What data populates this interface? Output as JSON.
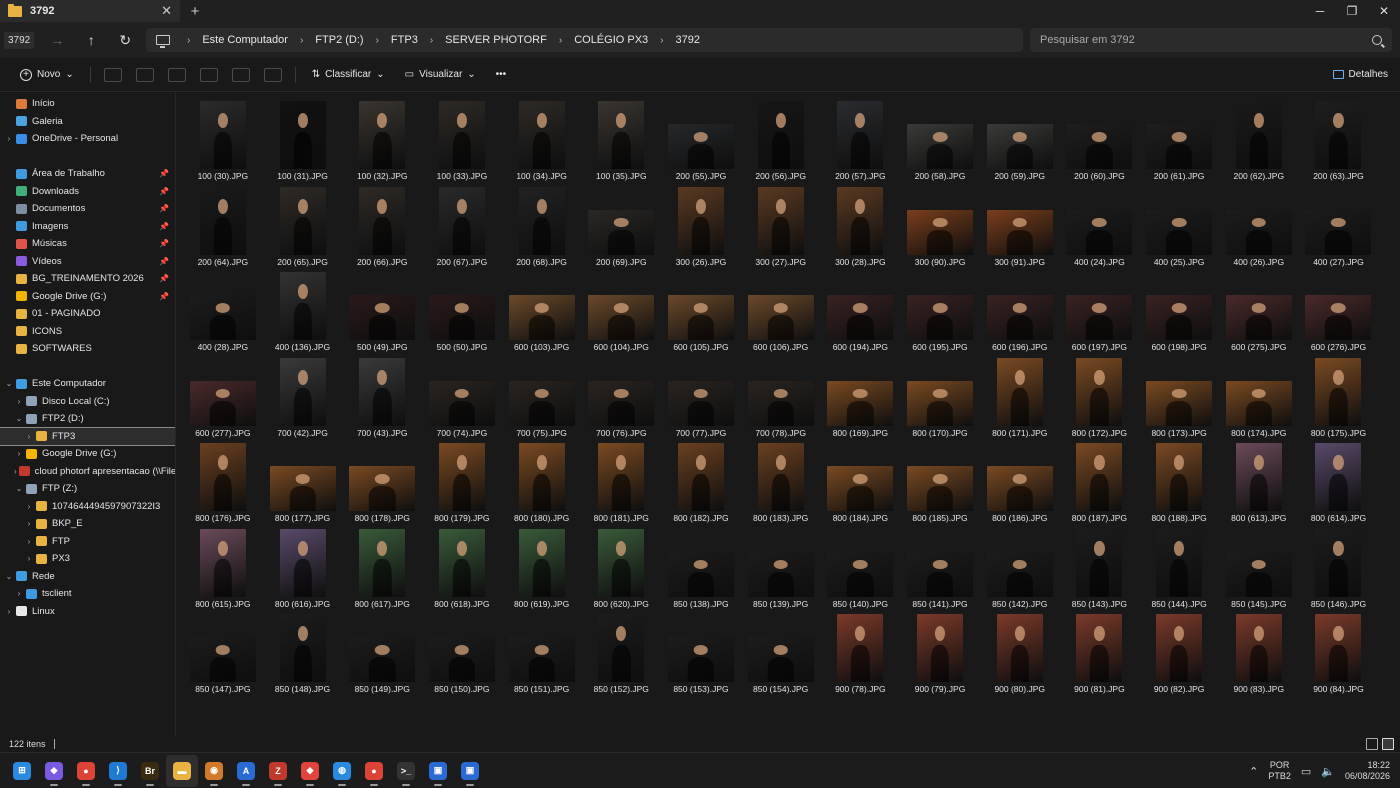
{
  "window": {
    "tab_title": "3792",
    "mini_title": "3792"
  },
  "breadcrumb": [
    "Este Computador",
    "FTP2 (D:)",
    "FTP3",
    "SERVER PHOTORF",
    "COLÉGIO PX3",
    "3792"
  ],
  "search": {
    "placeholder": "Pesquisar em 3792"
  },
  "toolbar": {
    "new_label": "Novo",
    "sort_label": "Classificar",
    "view_label": "Visualizar",
    "details_label": "Detalhes"
  },
  "sidebar": {
    "quick": [
      {
        "label": "Início",
        "icon": "home-icon",
        "color": "#e07a3c"
      },
      {
        "label": "Galeria",
        "icon": "gallery-icon",
        "color": "#4aa3df"
      },
      {
        "label": "OneDrive - Personal",
        "icon": "cloud-icon",
        "color": "#3a8ee6",
        "chev": "›"
      }
    ],
    "pinned": [
      {
        "label": "Área de Trabalho",
        "icon": "desktop-icon",
        "color": "#3f9be0"
      },
      {
        "label": "Downloads",
        "icon": "download-icon",
        "color": "#3fb07a"
      },
      {
        "label": "Documentos",
        "icon": "documents-icon",
        "color": "#7d8ea3"
      },
      {
        "label": "Imagens",
        "icon": "pictures-icon",
        "color": "#3f9be0"
      },
      {
        "label": "Músicas",
        "icon": "music-icon",
        "color": "#e0544a"
      },
      {
        "label": "Vídeos",
        "icon": "video-icon",
        "color": "#8a5ae0"
      },
      {
        "label": "BG_TREINAMENTO 2026",
        "icon": "folder-icon",
        "color": "#e8b341"
      },
      {
        "label": "Google Drive (G:)",
        "icon": "drive-icon",
        "color": "#f4b400"
      },
      {
        "label": "01 - PAGINADO",
        "icon": "folder-icon",
        "color": "#e8b341"
      },
      {
        "label": "ICONS",
        "icon": "folder-icon",
        "color": "#e8b341"
      },
      {
        "label": "SOFTWARES",
        "icon": "folder-icon",
        "color": "#e8b341"
      }
    ],
    "tree": [
      {
        "label": "Este Computador",
        "icon": "pc-icon",
        "color": "#3f9be0",
        "chev": "⌄",
        "indent": 0
      },
      {
        "label": "Disco Local (C:)",
        "icon": "disk-icon",
        "color": "#8fa3b8",
        "chev": "›",
        "indent": 1
      },
      {
        "label": "FTP2 (D:)",
        "icon": "disk-icon",
        "color": "#8fa3b8",
        "chev": "⌄",
        "indent": 1
      },
      {
        "label": "FTP3",
        "icon": "folder-icon",
        "color": "#e8b341",
        "chev": "›",
        "indent": 2,
        "selected": true
      },
      {
        "label": "Google Drive (G:)",
        "icon": "drive-icon",
        "color": "#f4b400",
        "chev": "›",
        "indent": 1
      },
      {
        "label": "cloud photorf apresentacao (\\\\Files",
        "icon": "network-drive-icon",
        "color": "#c0392b",
        "chev": "›",
        "indent": 1
      },
      {
        "label": "FTP (Z:)",
        "icon": "network-drive-icon",
        "color": "#8fa3b8",
        "chev": "⌄",
        "indent": 1
      },
      {
        "label": "1074644494597907322I3",
        "icon": "folder-icon",
        "color": "#e8b341",
        "chev": "›",
        "indent": 2
      },
      {
        "label": "BKP_E",
        "icon": "folder-icon",
        "color": "#e8b341",
        "chev": "›",
        "indent": 2
      },
      {
        "label": "FTP",
        "icon": "folder-icon",
        "color": "#e8b341",
        "chev": "›",
        "indent": 2
      },
      {
        "label": "PX3",
        "icon": "folder-icon",
        "color": "#e8b341",
        "chev": "›",
        "indent": 2
      },
      {
        "label": "Rede",
        "icon": "network-icon",
        "color": "#3f9be0",
        "chev": "⌄",
        "indent": 0
      },
      {
        "label": "tsclient",
        "icon": "pc-icon",
        "color": "#3f9be0",
        "chev": "›",
        "indent": 1
      },
      {
        "label": "Linux",
        "icon": "linux-icon",
        "color": "#e8e8e8",
        "chev": "›",
        "indent": 0
      }
    ]
  },
  "files": [
    {
      "name": "100 (30).JPG",
      "o": "p",
      "c": "#2b2b2b"
    },
    {
      "name": "100 (31).JPG",
      "o": "p",
      "c": "#111111"
    },
    {
      "name": "100 (32).JPG",
      "o": "p",
      "c": "#3a3530"
    },
    {
      "name": "100 (33).JPG",
      "o": "p",
      "c": "#2e2a26"
    },
    {
      "name": "100 (34).JPG",
      "o": "p",
      "c": "#2e2a26"
    },
    {
      "name": "100 (35).JPG",
      "o": "p",
      "c": "#3a3530"
    },
    {
      "name": "200 (55).JPG",
      "o": "l",
      "c": "#26282a"
    },
    {
      "name": "200 (56).JPG",
      "o": "p",
      "c": "#161616"
    },
    {
      "name": "200 (57).JPG",
      "o": "p",
      "c": "#2a2c30"
    },
    {
      "name": "200 (58).JPG",
      "o": "l",
      "c": "#3a3a38"
    },
    {
      "name": "200 (59).JPG",
      "o": "l",
      "c": "#3a3a38"
    },
    {
      "name": "200 (60).JPG",
      "o": "l",
      "c": "#1e1e1e"
    },
    {
      "name": "200 (61).JPG",
      "o": "l",
      "c": "#1e1e1e"
    },
    {
      "name": "200 (62).JPG",
      "o": "p",
      "c": "#1a1a1a"
    },
    {
      "name": "200 (63).JPG",
      "o": "p",
      "c": "#1e1e1e"
    },
    {
      "name": "200 (64).JPG",
      "o": "p",
      "c": "#1a1a1a"
    },
    {
      "name": "200 (65).JPG",
      "o": "p",
      "c": "#2e2a26"
    },
    {
      "name": "200 (66).JPG",
      "o": "p",
      "c": "#2e2a26"
    },
    {
      "name": "200 (67).JPG",
      "o": "p",
      "c": "#2a2a2a"
    },
    {
      "name": "200 (68).JPG",
      "o": "p",
      "c": "#222222"
    },
    {
      "name": "200 (69).JPG",
      "o": "l",
      "c": "#2a2826"
    },
    {
      "name": "300 (26).JPG",
      "o": "p",
      "c": "#5a3a22"
    },
    {
      "name": "300 (27).JPG",
      "o": "p",
      "c": "#5a3a22"
    },
    {
      "name": "300 (28).JPG",
      "o": "p",
      "c": "#5a3a22"
    },
    {
      "name": "300 (90).JPG",
      "o": "l",
      "c": "#7a3e1c"
    },
    {
      "name": "300 (91).JPG",
      "o": "l",
      "c": "#7a3e1c"
    },
    {
      "name": "400 (24).JPG",
      "o": "l",
      "c": "#1c1c1c"
    },
    {
      "name": "400 (25).JPG",
      "o": "l",
      "c": "#1c1c1c"
    },
    {
      "name": "400 (26).JPG",
      "o": "l",
      "c": "#1c1c1c"
    },
    {
      "name": "400 (27).JPG",
      "o": "l",
      "c": "#1c1c1c"
    },
    {
      "name": "400 (28).JPG",
      "o": "l",
      "c": "#1c1c1c"
    },
    {
      "name": "400 (136).JPG",
      "o": "p",
      "c": "#333333"
    },
    {
      "name": "500 (49).JPG",
      "o": "l",
      "c": "#2a1a1a"
    },
    {
      "name": "500 (50).JPG",
      "o": "l",
      "c": "#2a1a1a"
    },
    {
      "name": "600 (103).JPG",
      "o": "l",
      "c": "#6a4a2a"
    },
    {
      "name": "600 (104).JPG",
      "o": "l",
      "c": "#6a4a2a"
    },
    {
      "name": "600 (105).JPG",
      "o": "l",
      "c": "#6a4a2a"
    },
    {
      "name": "600 (106).JPG",
      "o": "l",
      "c": "#6a4a2a"
    },
    {
      "name": "600 (194).JPG",
      "o": "l",
      "c": "#3a2222"
    },
    {
      "name": "600 (195).JPG",
      "o": "l",
      "c": "#3a2222"
    },
    {
      "name": "600 (196).JPG",
      "o": "l",
      "c": "#3a2222"
    },
    {
      "name": "600 (197).JPG",
      "o": "l",
      "c": "#3a2222"
    },
    {
      "name": "600 (198).JPG",
      "o": "l",
      "c": "#3a2222"
    },
    {
      "name": "600 (275).JPG",
      "o": "l",
      "c": "#4a2a2a"
    },
    {
      "name": "600 (276).JPG",
      "o": "l",
      "c": "#4a2a2a"
    },
    {
      "name": "600 (277).JPG",
      "o": "l",
      "c": "#4a2a2a"
    },
    {
      "name": "700 (42).JPG",
      "o": "p",
      "c": "#3a3a3a"
    },
    {
      "name": "700 (43).JPG",
      "o": "p",
      "c": "#3a3a3a"
    },
    {
      "name": "700 (74).JPG",
      "o": "l",
      "c": "#2a2420"
    },
    {
      "name": "700 (75).JPG",
      "o": "l",
      "c": "#2a2420"
    },
    {
      "name": "700 (76).JPG",
      "o": "l",
      "c": "#2a2420"
    },
    {
      "name": "700 (77).JPG",
      "o": "l",
      "c": "#2a2420"
    },
    {
      "name": "700 (78).JPG",
      "o": "l",
      "c": "#2a2420"
    },
    {
      "name": "800 (169).JPG",
      "o": "l",
      "c": "#7a4a22"
    },
    {
      "name": "800 (170).JPG",
      "o": "l",
      "c": "#7a4a22"
    },
    {
      "name": "800 (171).JPG",
      "o": "p",
      "c": "#7a4a22"
    },
    {
      "name": "800 (172).JPG",
      "o": "p",
      "c": "#7a4a22"
    },
    {
      "name": "800 (173).JPG",
      "o": "l",
      "c": "#7a4a22"
    },
    {
      "name": "800 (174).JPG",
      "o": "l",
      "c": "#7a4a22"
    },
    {
      "name": "800 (175).JPG",
      "o": "p",
      "c": "#7a4a22"
    },
    {
      "name": "800 (176).JPG",
      "o": "p",
      "c": "#6a4020"
    },
    {
      "name": "800 (177).JPG",
      "o": "l",
      "c": "#7a4a22"
    },
    {
      "name": "800 (178).JPG",
      "o": "l",
      "c": "#7a4a22"
    },
    {
      "name": "800 (179).JPG",
      "o": "p",
      "c": "#7a4a22"
    },
    {
      "name": "800 (180).JPG",
      "o": "p",
      "c": "#7a4a22"
    },
    {
      "name": "800 (181).JPG",
      "o": "p",
      "c": "#7a4a22"
    },
    {
      "name": "800 (182).JPG",
      "o": "p",
      "c": "#6a4020"
    },
    {
      "name": "800 (183).JPG",
      "o": "p",
      "c": "#6a4020"
    },
    {
      "name": "800 (184).JPG",
      "o": "l",
      "c": "#7a4a22"
    },
    {
      "name": "800 (185).JPG",
      "o": "l",
      "c": "#7a4a22"
    },
    {
      "name": "800 (186).JPG",
      "o": "l",
      "c": "#7a4a22"
    },
    {
      "name": "800 (187).JPG",
      "o": "p",
      "c": "#7a4a22"
    },
    {
      "name": "800 (188).JPG",
      "o": "p",
      "c": "#7a4a22"
    },
    {
      "name": "800 (613).JPG",
      "o": "p",
      "c": "#6a4a5a"
    },
    {
      "name": "800 (614).JPG",
      "o": "p",
      "c": "#5a4a6a"
    },
    {
      "name": "800 (615).JPG",
      "o": "p",
      "c": "#6a4a5a"
    },
    {
      "name": "800 (616).JPG",
      "o": "p",
      "c": "#5a4a6a"
    },
    {
      "name": "800 (617).JPG",
      "o": "p",
      "c": "#3a5a3a"
    },
    {
      "name": "800 (618).JPG",
      "o": "p",
      "c": "#3a5a3a"
    },
    {
      "name": "800 (619).JPG",
      "o": "p",
      "c": "#3a5a3a"
    },
    {
      "name": "800 (620).JPG",
      "o": "p",
      "c": "#3a5a3a"
    },
    {
      "name": "850 (138).JPG",
      "o": "l",
      "c": "#1c1c1c"
    },
    {
      "name": "850 (139).JPG",
      "o": "l",
      "c": "#1c1c1c"
    },
    {
      "name": "850 (140).JPG",
      "o": "l",
      "c": "#1c1c1c"
    },
    {
      "name": "850 (141).JPG",
      "o": "l",
      "c": "#1c1c1c"
    },
    {
      "name": "850 (142).JPG",
      "o": "l",
      "c": "#1c1c1c"
    },
    {
      "name": "850 (143).JPG",
      "o": "p",
      "c": "#1c1c1c"
    },
    {
      "name": "850 (144).JPG",
      "o": "p",
      "c": "#1c1c1c"
    },
    {
      "name": "850 (145).JPG",
      "o": "l",
      "c": "#1c1c1c"
    },
    {
      "name": "850 (146).JPG",
      "o": "p",
      "c": "#1c1c1c"
    },
    {
      "name": "850 (147).JPG",
      "o": "l",
      "c": "#1c1c1c"
    },
    {
      "name": "850 (148).JPG",
      "o": "p",
      "c": "#1c1c1c"
    },
    {
      "name": "850 (149).JPG",
      "o": "l",
      "c": "#1c1c1c"
    },
    {
      "name": "850 (150).JPG",
      "o": "l",
      "c": "#1c1c1c"
    },
    {
      "name": "850 (151).JPG",
      "o": "l",
      "c": "#1c1c1c"
    },
    {
      "name": "850 (152).JPG",
      "o": "p",
      "c": "#1c1c1c"
    },
    {
      "name": "850 (153).JPG",
      "o": "l",
      "c": "#1c1c1c"
    },
    {
      "name": "850 (154).JPG",
      "o": "l",
      "c": "#1c1c1c"
    },
    {
      "name": "900 (78).JPG",
      "o": "p",
      "c": "#7a3a2a"
    },
    {
      "name": "900 (79).JPG",
      "o": "p",
      "c": "#7a3a2a"
    },
    {
      "name": "900 (80).JPG",
      "o": "p",
      "c": "#7a3a2a"
    },
    {
      "name": "900 (81).JPG",
      "o": "p",
      "c": "#7a3a2a"
    },
    {
      "name": "900 (82).JPG",
      "o": "p",
      "c": "#7a3a2a"
    },
    {
      "name": "900 (83).JPG",
      "o": "p",
      "c": "#7a3a2a"
    },
    {
      "name": "900 (84).JPG",
      "o": "p",
      "c": "#7a3a2a"
    }
  ],
  "status": {
    "count": "122 itens"
  },
  "taskbar": {
    "apps": [
      {
        "name": "start-icon",
        "color": "#2a8ae0",
        "glyph": "⊞"
      },
      {
        "name": "copilot-icon",
        "color": "#7a5ae0",
        "glyph": "◆"
      },
      {
        "name": "chrome-icon",
        "color": "#db4437",
        "glyph": "●"
      },
      {
        "name": "vscode-icon",
        "color": "#1f7ad4",
        "glyph": "⟩"
      },
      {
        "name": "bridge-icon",
        "color": "#3a2a10",
        "glyph": "Br"
      },
      {
        "name": "explorer-icon",
        "color": "#e8b341",
        "glyph": "▬",
        "active": true
      },
      {
        "name": "photo-app-icon",
        "color": "#d07a2a",
        "glyph": "◉"
      },
      {
        "name": "translate-icon",
        "color": "#2a6ad4",
        "glyph": "A"
      },
      {
        "name": "filezilla-icon",
        "color": "#c0392b",
        "glyph": "Z"
      },
      {
        "name": "anydesk-icon",
        "color": "#e0443a",
        "glyph": "◆"
      },
      {
        "name": "browser-icon",
        "color": "#2a8ae0",
        "glyph": "◍"
      },
      {
        "name": "chrome-profile-icon",
        "color": "#db4437",
        "glyph": "●"
      },
      {
        "name": "terminal-icon",
        "color": "#333333",
        "glyph": ">_"
      },
      {
        "name": "remote-desktop-icon",
        "color": "#2a6ad4",
        "glyph": "▣"
      },
      {
        "name": "remote-desktop-2-icon",
        "color": "#2a6ad4",
        "glyph": "▣"
      }
    ],
    "lang_top": "POR",
    "lang_bottom": "PTB2",
    "time": "18:22",
    "date": "06/08/2026"
  }
}
